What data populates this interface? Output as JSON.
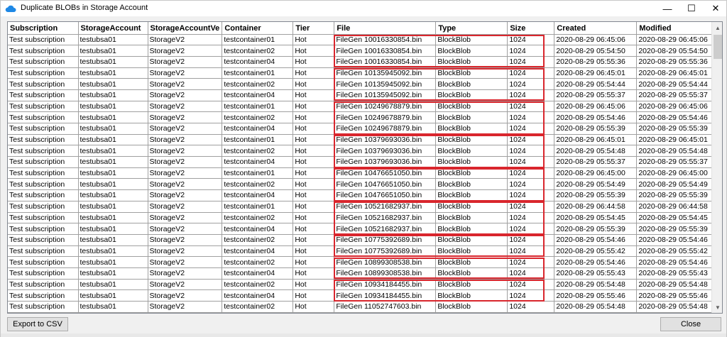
{
  "window": {
    "title": "Duplicate BLOBs in Storage Account",
    "minimize_glyph": "—",
    "maximize_glyph": "☐",
    "close_glyph": "✕",
    "icon": "cloud-icon",
    "accent_color": "#1e88e5"
  },
  "grid": {
    "columns": [
      "Subscription",
      "StorageAccount",
      "StorageAccountVe",
      "Container",
      "Tier",
      "File",
      "Type",
      "Size",
      "Created",
      "Modified"
    ],
    "rows": [
      [
        "Test subscription",
        "testubsa01",
        "StorageV2",
        "testcontainer01",
        "Hot",
        "FileGen 10016330854.bin",
        "BlockBlob",
        "1024",
        "2020-08-29 06:45:06",
        "2020-08-29 06:45:06"
      ],
      [
        "Test subscription",
        "testubsa01",
        "StorageV2",
        "testcontainer02",
        "Hot",
        "FileGen 10016330854.bin",
        "BlockBlob",
        "1024",
        "2020-08-29 05:54:50",
        "2020-08-29 05:54:50"
      ],
      [
        "Test subscription",
        "testubsa01",
        "StorageV2",
        "testcontainer04",
        "Hot",
        "FileGen 10016330854.bin",
        "BlockBlob",
        "1024",
        "2020-08-29 05:55:36",
        "2020-08-29 05:55:36"
      ],
      [
        "Test subscription",
        "testubsa01",
        "StorageV2",
        "testcontainer01",
        "Hot",
        "FileGen 10135945092.bin",
        "BlockBlob",
        "1024",
        "2020-08-29 06:45:01",
        "2020-08-29 06:45:01"
      ],
      [
        "Test subscription",
        "testubsa01",
        "StorageV2",
        "testcontainer02",
        "Hot",
        "FileGen 10135945092.bin",
        "BlockBlob",
        "1024",
        "2020-08-29 05:54:44",
        "2020-08-29 05:54:44"
      ],
      [
        "Test subscription",
        "testubsa01",
        "StorageV2",
        "testcontainer04",
        "Hot",
        "FileGen 10135945092.bin",
        "BlockBlob",
        "1024",
        "2020-08-29 05:55:37",
        "2020-08-29 05:55:37"
      ],
      [
        "Test subscription",
        "testubsa01",
        "StorageV2",
        "testcontainer01",
        "Hot",
        "FileGen 10249678879.bin",
        "BlockBlob",
        "1024",
        "2020-08-29 06:45:06",
        "2020-08-29 06:45:06"
      ],
      [
        "Test subscription",
        "testubsa01",
        "StorageV2",
        "testcontainer02",
        "Hot",
        "FileGen 10249678879.bin",
        "BlockBlob",
        "1024",
        "2020-08-29 05:54:46",
        "2020-08-29 05:54:46"
      ],
      [
        "Test subscription",
        "testubsa01",
        "StorageV2",
        "testcontainer04",
        "Hot",
        "FileGen 10249678879.bin",
        "BlockBlob",
        "1024",
        "2020-08-29 05:55:39",
        "2020-08-29 05:55:39"
      ],
      [
        "Test subscription",
        "testubsa01",
        "StorageV2",
        "testcontainer01",
        "Hot",
        "FileGen 10379693036.bin",
        "BlockBlob",
        "1024",
        "2020-08-29 06:45:01",
        "2020-08-29 06:45:01"
      ],
      [
        "Test subscription",
        "testubsa01",
        "StorageV2",
        "testcontainer02",
        "Hot",
        "FileGen 10379693036.bin",
        "BlockBlob",
        "1024",
        "2020-08-29 05:54:48",
        "2020-08-29 05:54:48"
      ],
      [
        "Test subscription",
        "testubsa01",
        "StorageV2",
        "testcontainer04",
        "Hot",
        "FileGen 10379693036.bin",
        "BlockBlob",
        "1024",
        "2020-08-29 05:55:37",
        "2020-08-29 05:55:37"
      ],
      [
        "Test subscription",
        "testubsa01",
        "StorageV2",
        "testcontainer01",
        "Hot",
        "FileGen 10476651050.bin",
        "BlockBlob",
        "1024",
        "2020-08-29 06:45:00",
        "2020-08-29 06:45:00"
      ],
      [
        "Test subscription",
        "testubsa01",
        "StorageV2",
        "testcontainer02",
        "Hot",
        "FileGen 10476651050.bin",
        "BlockBlob",
        "1024",
        "2020-08-29 05:54:49",
        "2020-08-29 05:54:49"
      ],
      [
        "Test subscription",
        "testubsa01",
        "StorageV2",
        "testcontainer04",
        "Hot",
        "FileGen 10476651050.bin",
        "BlockBlob",
        "1024",
        "2020-08-29 05:55:39",
        "2020-08-29 05:55:39"
      ],
      [
        "Test subscription",
        "testubsa01",
        "StorageV2",
        "testcontainer01",
        "Hot",
        "FileGen 10521682937.bin",
        "BlockBlob",
        "1024",
        "2020-08-29 06:44:58",
        "2020-08-29 06:44:58"
      ],
      [
        "Test subscription",
        "testubsa01",
        "StorageV2",
        "testcontainer02",
        "Hot",
        "FileGen 10521682937.bin",
        "BlockBlob",
        "1024",
        "2020-08-29 05:54:45",
        "2020-08-29 05:54:45"
      ],
      [
        "Test subscription",
        "testubsa01",
        "StorageV2",
        "testcontainer04",
        "Hot",
        "FileGen 10521682937.bin",
        "BlockBlob",
        "1024",
        "2020-08-29 05:55:39",
        "2020-08-29 05:55:39"
      ],
      [
        "Test subscription",
        "testubsa01",
        "StorageV2",
        "testcontainer02",
        "Hot",
        "FileGen 10775392689.bin",
        "BlockBlob",
        "1024",
        "2020-08-29 05:54:46",
        "2020-08-29 05:54:46"
      ],
      [
        "Test subscription",
        "testubsa01",
        "StorageV2",
        "testcontainer04",
        "Hot",
        "FileGen 10775392689.bin",
        "BlockBlob",
        "1024",
        "2020-08-29 05:55:42",
        "2020-08-29 05:55:42"
      ],
      [
        "Test subscription",
        "testubsa01",
        "StorageV2",
        "testcontainer02",
        "Hot",
        "FileGen 10899308538.bin",
        "BlockBlob",
        "1024",
        "2020-08-29 05:54:46",
        "2020-08-29 05:54:46"
      ],
      [
        "Test subscription",
        "testubsa01",
        "StorageV2",
        "testcontainer04",
        "Hot",
        "FileGen 10899308538.bin",
        "BlockBlob",
        "1024",
        "2020-08-29 05:55:43",
        "2020-08-29 05:55:43"
      ],
      [
        "Test subscription",
        "testubsa01",
        "StorageV2",
        "testcontainer02",
        "Hot",
        "FileGen 10934184455.bin",
        "BlockBlob",
        "1024",
        "2020-08-29 05:54:48",
        "2020-08-29 05:54:48"
      ],
      [
        "Test subscription",
        "testubsa01",
        "StorageV2",
        "testcontainer04",
        "Hot",
        "FileGen 10934184455.bin",
        "BlockBlob",
        "1024",
        "2020-08-29 05:55:46",
        "2020-08-29 05:55:46"
      ],
      [
        "Test subscription",
        "testubsa01",
        "StorageV2",
        "testcontainer02",
        "Hot",
        "FileGen 11052747603.bin",
        "BlockBlob",
        "1024",
        "2020-08-29 05:54:48",
        "2020-08-29 05:54:48"
      ]
    ],
    "highlight_groups": [
      [
        0,
        2
      ],
      [
        3,
        5
      ],
      [
        6,
        8
      ],
      [
        9,
        11
      ],
      [
        12,
        14
      ],
      [
        15,
        17
      ],
      [
        18,
        19
      ],
      [
        20,
        21
      ],
      [
        22,
        23
      ]
    ],
    "highlight_color": "#d9262d"
  },
  "footer": {
    "export_label": "Export to CSV",
    "close_label": "Close"
  }
}
